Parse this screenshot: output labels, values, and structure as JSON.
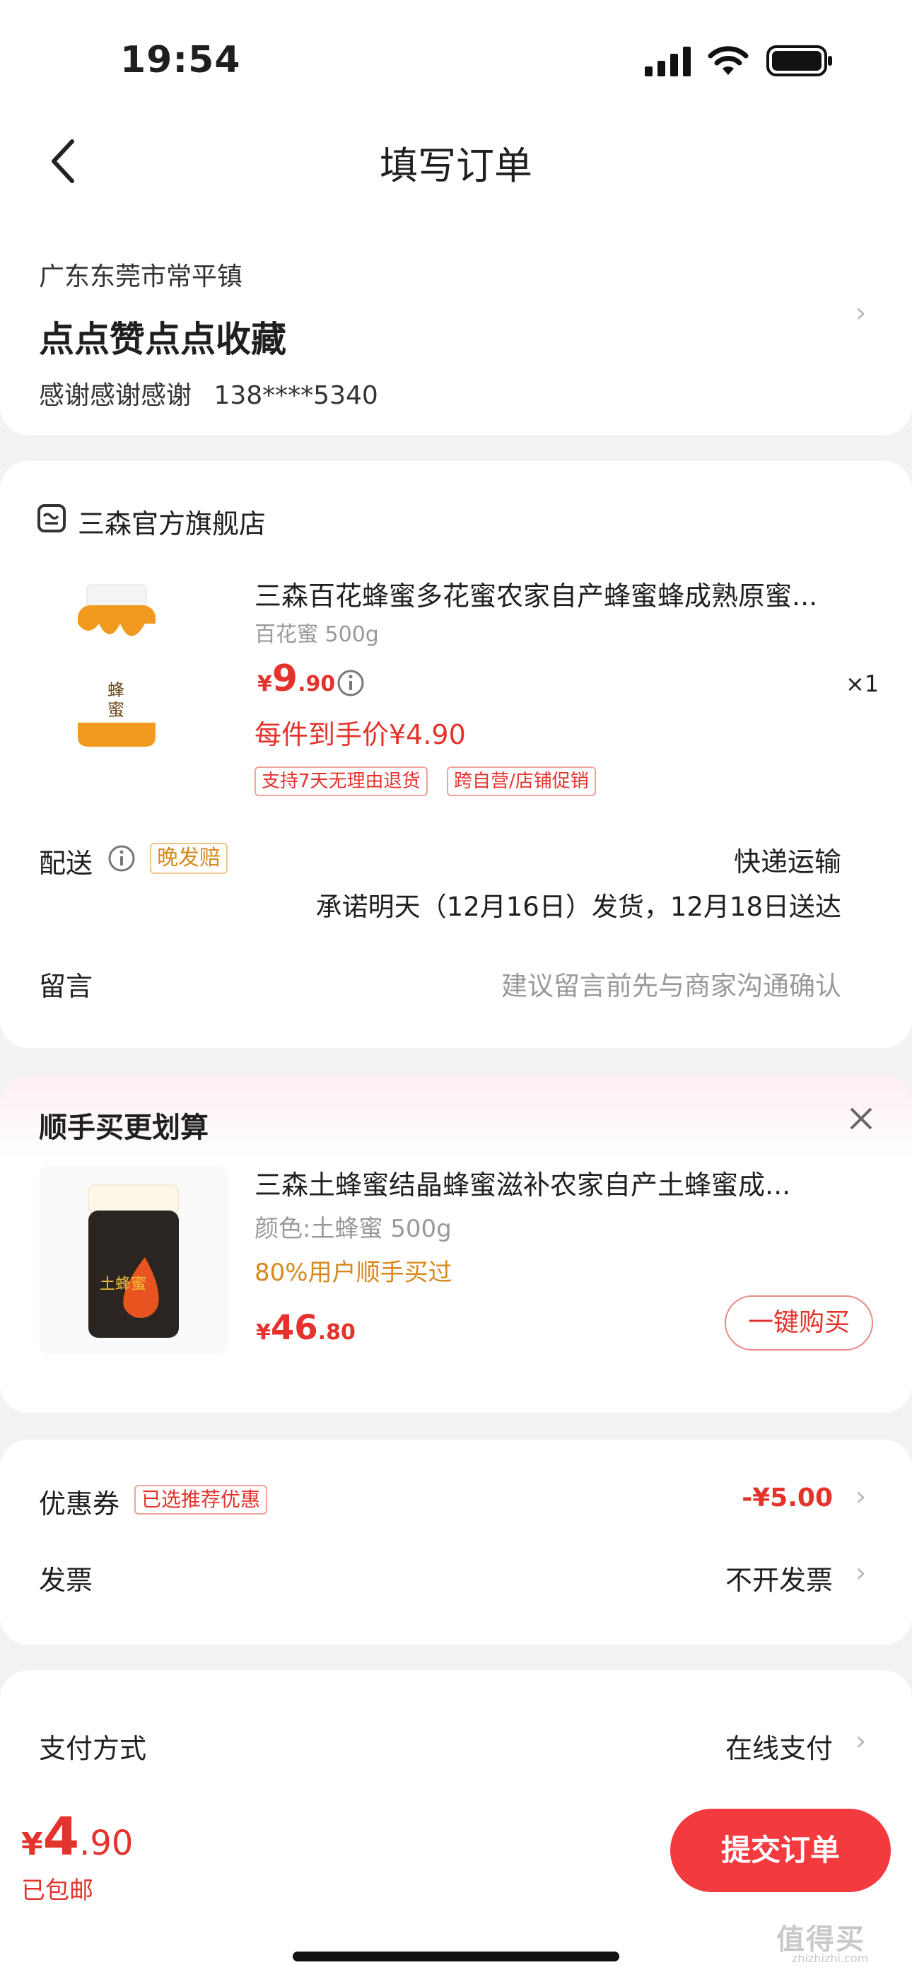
{
  "status_bar": {
    "time": "19:54"
  },
  "nav": {
    "title": "填写订单"
  },
  "address": {
    "region": "广东东莞市常平镇",
    "detail": "点点赞点点收藏",
    "contact_name": "感谢感谢感谢",
    "phone": "138****5340"
  },
  "store": {
    "name": "三森官方旗舰店",
    "product": {
      "title": "三森百花蜂蜜多花蜜农家自产蜂蜜蜂成熟原蜜...",
      "spec": "百花蜜 500g",
      "price_symbol": "¥",
      "price_int": "9",
      "price_dec": ".90",
      "final_price": "每件到手价¥4.90",
      "quantity": "×1",
      "tags": [
        "支持7天无理由退货",
        "跨自营/店铺促销"
      ],
      "jar_label": "蜂蜜"
    },
    "delivery": {
      "label": "配送",
      "badge": "晚发赔",
      "method": "快递运输",
      "eta": "承诺明天（12月16日）发货，12月18日送达"
    },
    "message": {
      "label": "留言",
      "placeholder": "建议留言前先与商家沟通确认"
    }
  },
  "upsell": {
    "title": "顺手买更划算",
    "product": {
      "title": "三森土蜂蜜结晶蜂蜜滋补农家自产土蜂蜜成...",
      "spec": "颜色:土蜂蜜 500g",
      "social": "80%用户顺手买过",
      "price_symbol": "¥",
      "price_int": "46",
      "price_dec": ".80",
      "jar_label": "土蜂蜜"
    },
    "buy_button": "一键购买"
  },
  "coupon": {
    "label": "优惠券",
    "badge": "已选推荐优惠",
    "value": "-¥5.00"
  },
  "invoice": {
    "label": "发票",
    "value": "不开发票"
  },
  "payment": {
    "label": "支付方式",
    "value": "在线支付"
  },
  "footer": {
    "price_symbol": "¥",
    "price_int": "4",
    "price_dec": ".90",
    "shipping": "已包邮",
    "submit": "提交订单"
  },
  "watermark": {
    "text": "值得买",
    "sub": "zhizhizhi.com"
  }
}
